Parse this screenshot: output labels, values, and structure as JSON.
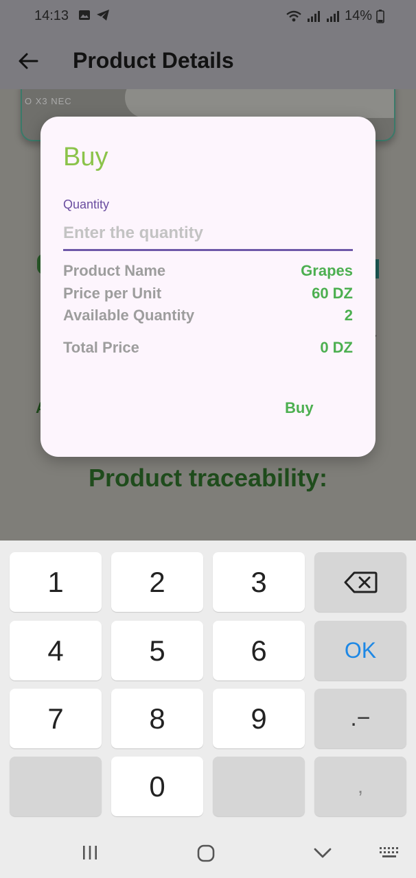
{
  "status_bar": {
    "time": "14:13",
    "battery": "14%",
    "icons": [
      "image-icon",
      "telegram-icon",
      "wifi-icon",
      "signal-icon",
      "signal-icon",
      "battery-icon"
    ]
  },
  "app_bar": {
    "title": "Product Details",
    "back_icon": "arrow-left-icon"
  },
  "background": {
    "image_caption": "O X3 NEC",
    "section_title": "Product traceability:",
    "partial_text_left": "A"
  },
  "dialog": {
    "title": "Buy",
    "quantity_label": "Quantity",
    "quantity_placeholder": "Enter the quantity",
    "quantity_value": "",
    "rows": [
      {
        "label": "Product Name",
        "value": "Grapes"
      },
      {
        "label": "Price per Unit",
        "value": "60 DZ"
      },
      {
        "label": "Available Quantity",
        "value": "2"
      }
    ],
    "total": {
      "label": "Total Price",
      "value": "0 DZ"
    },
    "action_label": "Buy",
    "colors": {
      "title": "#8bc34a",
      "value": "#4caf50",
      "accent": "#6e58a8"
    }
  },
  "keyboard": {
    "keys": [
      [
        "1",
        "2",
        "3",
        "backspace-icon"
      ],
      [
        "4",
        "5",
        "6",
        "OK"
      ],
      [
        "7",
        "8",
        "9",
        ".−"
      ],
      [
        "",
        "0",
        "",
        ","
      ]
    ],
    "ok_color": "#1e88e5"
  },
  "navbar": {
    "icons": [
      "recent-apps-icon",
      "home-icon",
      "back-chevron-icon",
      "keyboard-icon"
    ]
  }
}
